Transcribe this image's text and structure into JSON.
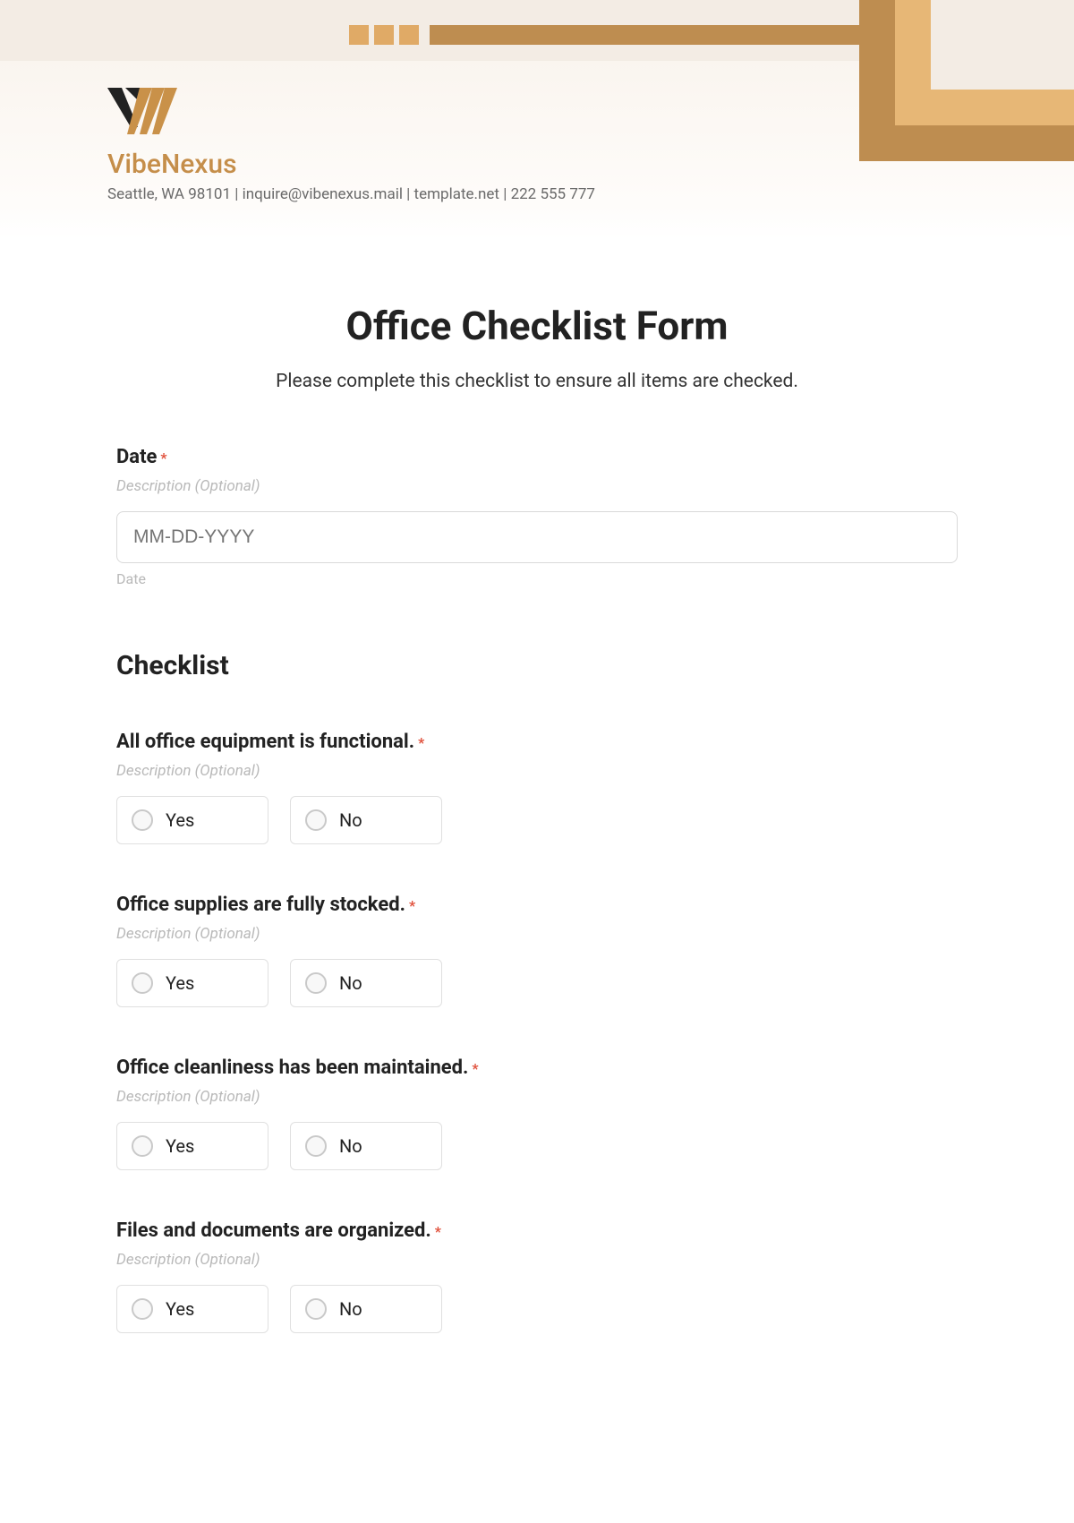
{
  "brand": {
    "name": "VibeNexus",
    "sub": "Seattle, WA 98101 | inquire@vibenexus.mail | template.net | 222 555 777"
  },
  "form": {
    "title": "Office Checklist Form",
    "subtitle": "Please complete this checklist to ensure all items are checked.",
    "date_label": "Date",
    "desc_placeholder": "Description (Optional)",
    "date_placeholder": "MM-DD-YYYY",
    "date_sublabel": "Date",
    "checklist_heading": "Checklist",
    "yes": "Yes",
    "no": "No",
    "questions": [
      "All office equipment is functional.",
      "Office supplies are fully stocked.",
      "Office cleanliness has been maintained.",
      "Files and documents are organized."
    ]
  },
  "colors": {
    "accent1": "#e0aa66",
    "accent2": "#be8d50"
  }
}
